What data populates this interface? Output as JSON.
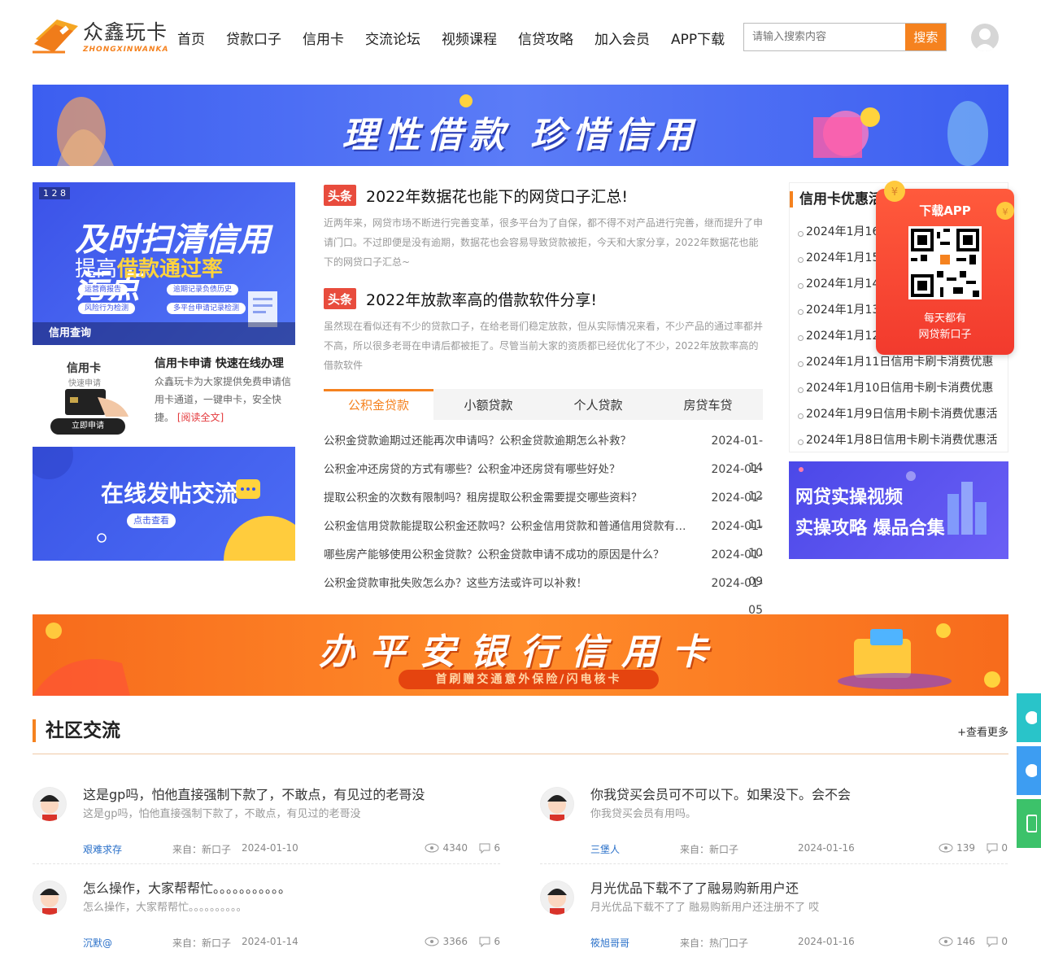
{
  "logo": {
    "name": "众鑫玩卡",
    "sub": "ZHONGXINWANKA"
  },
  "nav": [
    "首页",
    "贷款口子",
    "信用卡",
    "交流论坛",
    "视频课程",
    "信贷攻略",
    "加入会员",
    "APP下载"
  ],
  "search": {
    "placeholder": "请输入搜索内容",
    "button": "搜索"
  },
  "banner_top": {
    "slogan": "理性借款  珍惜信用"
  },
  "slider": {
    "pager": "1 2",
    "pager_suffix": "8",
    "line1": "及时扫清信用污点",
    "line2_a": "提高",
    "line2_b": "借款通过率",
    "tags": [
      "运营商报告",
      "逾期记录负债历史",
      "风险行为检测",
      "多平台申请记录检测"
    ],
    "caption": "信用查询"
  },
  "card_block": {
    "pic_title": "信用卡",
    "pic_sub": "快速申请",
    "pic_btn": "立即申请",
    "title": "信用卡申请 快速在线办理",
    "desc": "众鑫玩卡为大家提供免费申请信用卡通道，一键申卡，安全快捷。",
    "more": "[阅读全文]"
  },
  "forum_banner": {
    "title": "在线发帖交流",
    "button": "点击查看"
  },
  "headlines": [
    {
      "tag": "头条",
      "title": "2022年数据花也能下的网贷口子汇总!",
      "summary": "近两年来，网贷市场不断进行完善变革，很多平台为了自保，都不得不对产品进行完善，继而提升了申请门口。不过即便是没有逾期，数据花也会容易导致贷款被拒，今天和大家分享，2022年数据花也能下的网贷口子汇总~"
    },
    {
      "tag": "头条",
      "title": "2022年放款率高的借款软件分享!",
      "summary": "虽然现在看似还有不少的贷款口子，在给老哥们稳定放款，但从实际情况来看，不少产品的通过率都并不高，所以很多老哥在申请后都被拒了。尽管当前大家的资质都已经优化了不少，2022年放款率高的借款软件"
    }
  ],
  "tabs": [
    "公积金贷款",
    "小额贷款",
    "个人贷款",
    "房贷车贷"
  ],
  "news": [
    {
      "title": "公积金贷款逾期过还能再次申请吗？公积金贷款逾期怎么补救？",
      "date": "2024-01-14"
    },
    {
      "title": "公积金冲还房贷的方式有哪些？公积金冲还房贷有哪些好处？",
      "date": "2024-01-12"
    },
    {
      "title": "提取公积金的次数有限制吗？租房提取公积金需要提交哪些资料？",
      "date": "2024-01-11"
    },
    {
      "title": "公积金信用贷款能提取公积金还款吗？公积金信用贷款和普通信用贷款有什么区别？",
      "date": "2024-01-10"
    },
    {
      "title": "哪些房产能够使用公积金贷款？公积金贷款申请不成功的原因是什么？",
      "date": "2024-01-09"
    },
    {
      "title": "公积金贷款审批失败怎么办？这些方法或许可以补救！",
      "date": "2024-01-05"
    }
  ],
  "promo": {
    "header": "信用卡优惠活动",
    "items": [
      "2024年1月16日信用卡刷卡消费优惠",
      "2024年1月15日信用卡刷卡消费优惠",
      "2024年1月14日信用卡刷卡消费优惠",
      "2024年1月13日信用卡刷卡消费优惠",
      "2024年1月12日信用卡刷卡消费优惠",
      "2024年1月11日信用卡刷卡消费优惠",
      "2024年1月10日信用卡刷卡消费优惠",
      "2024年1月9日信用卡刷卡消费优惠活",
      "2024年1月8日信用卡刷卡消费优惠活"
    ]
  },
  "qr_popup": {
    "title": "下载APP",
    "caption_1": "每天都有",
    "caption_2": "网贷新口子"
  },
  "video_banner": {
    "line1": "网贷实操视频",
    "line2": "实操攻略  爆品合集"
  },
  "banner_mid": {
    "title": "办平安银行信用卡",
    "sub": "首刷赠交通意外保险/闪电核卡"
  },
  "community": {
    "title": "社区交流",
    "more": "+查看更多",
    "posts": [
      {
        "title": "这是gp吗，怕他直接强制下款了，不敢点，有见过的老哥没",
        "summary": "这是gp吗，怕他直接强制下款了，不敢点，有见过的老哥没",
        "user": "艰难求存",
        "from": "来自：新口子",
        "date": "2024-01-10",
        "views": "4340",
        "comments": "6"
      },
      {
        "title": "你我贷买会员可不可以下。如果没下。会不会",
        "summary": "你我贷买会员有用吗。",
        "user": "三堡人",
        "from": "来自：新口子",
        "date": "2024-01-16",
        "views": "139",
        "comments": "0"
      },
      {
        "title": "怎么操作，大家帮帮忙。。。。。。。。。。。",
        "summary": "怎么操作，大家帮帮忙。。。。。。。。。。",
        "user": "沉默@",
        "from": "来自：新口子",
        "date": "2024-01-14",
        "views": "3366",
        "comments": "6"
      },
      {
        "title": "月光优品下载不了了融易购新用户还",
        "summary": "月光优品下载不了了 融易购新用户还注册不了 哎",
        "user": "筱旭哥哥",
        "from": "来自：热门口子",
        "date": "2024-01-16",
        "views": "146",
        "comments": "0"
      }
    ]
  },
  "colors": {
    "accent": "#f5821f",
    "blue": "#3c5ef0",
    "red": "#e84c3d"
  }
}
